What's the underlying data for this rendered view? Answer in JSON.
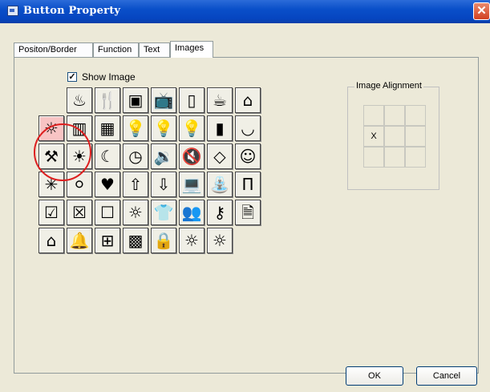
{
  "window": {
    "title": "Button Property",
    "close_label": "✕"
  },
  "tabs": [
    {
      "label": "Positon/Border"
    },
    {
      "label": "Function"
    },
    {
      "label": "Text"
    },
    {
      "label": "Images"
    }
  ],
  "show_image": {
    "label": "Show Image",
    "checked": true,
    "mark": "✓"
  },
  "icons": [
    [
      {
        "name": "heater-icon",
        "glyph": "♨"
      },
      {
        "name": "fork-knife-icon",
        "glyph": "🍴"
      },
      {
        "name": "oven-icon",
        "glyph": "▣"
      },
      {
        "name": "tv-icon",
        "glyph": "📺"
      },
      {
        "name": "document-icon",
        "glyph": "▯"
      },
      {
        "name": "coffee-cup-icon",
        "glyph": "☕"
      },
      {
        "name": "home-icon",
        "glyph": "⌂"
      }
    ],
    [
      {
        "name": "sun-selected-icon",
        "glyph": "☼",
        "selected": true
      },
      {
        "name": "piano-icon",
        "glyph": "▥"
      },
      {
        "name": "theater-icon",
        "glyph": "▦"
      },
      {
        "name": "lightbulb-on-icon",
        "glyph": "💡"
      },
      {
        "name": "lightbulb-glow-icon",
        "glyph": "💡"
      },
      {
        "name": "lightbulb-icon",
        "glyph": "💡"
      },
      {
        "name": "film-icon",
        "glyph": "▮"
      },
      {
        "name": "bowl-icon",
        "glyph": "◡"
      }
    ],
    [
      {
        "name": "tools-icon",
        "glyph": "⚒"
      },
      {
        "name": "lamp-icon",
        "glyph": "☀"
      },
      {
        "name": "moon-icon",
        "glyph": "☾"
      },
      {
        "name": "clock-icon",
        "glyph": "◷"
      },
      {
        "name": "speaker-icon",
        "glyph": "🔉"
      },
      {
        "name": "mute-icon",
        "glyph": "🔇"
      },
      {
        "name": "eraser-icon",
        "glyph": "◇"
      },
      {
        "name": "smiley-icon",
        "glyph": "☺"
      }
    ],
    [
      {
        "name": "sparkle-icon",
        "glyph": "✳"
      },
      {
        "name": "balloons-icon",
        "glyph": "⚪"
      },
      {
        "name": "hearts-icon",
        "glyph": "♥"
      },
      {
        "name": "arrow-up-icon",
        "glyph": "⇧"
      },
      {
        "name": "arrow-down-icon",
        "glyph": "⇩"
      },
      {
        "name": "computer-icon",
        "glyph": "💻"
      },
      {
        "name": "fountain-icon",
        "glyph": "⛲"
      },
      {
        "name": "curtain-icon",
        "glyph": "Π"
      }
    ],
    [
      {
        "name": "checked-box-icon",
        "glyph": "☑"
      },
      {
        "name": "crossed-box-icon",
        "glyph": "☒"
      },
      {
        "name": "empty-box-icon",
        "glyph": "☐"
      },
      {
        "name": "small-sun-icon",
        "glyph": "☼"
      },
      {
        "name": "shirt-icon",
        "glyph": "👕"
      },
      {
        "name": "people-icon",
        "glyph": "👥"
      },
      {
        "name": "key-icon",
        "glyph": "⚷"
      },
      {
        "name": "page-icon",
        "glyph": "🗎"
      }
    ],
    [
      {
        "name": "home-button-icon",
        "glyph": "⌂"
      },
      {
        "name": "bell-icon",
        "glyph": "🔔"
      },
      {
        "name": "presentation-icon",
        "glyph": "⊞"
      },
      {
        "name": "map-icon",
        "glyph": "▩"
      },
      {
        "name": "lock-icon",
        "glyph": "🔒"
      },
      {
        "name": "brightness-up-icon",
        "glyph": "☼"
      },
      {
        "name": "brightness-down-icon",
        "glyph": "☼"
      }
    ]
  ],
  "image_alignment": {
    "label": "Image Alignment",
    "cells": [
      "",
      "",
      "",
      "X",
      "",
      "",
      "",
      "",
      ""
    ]
  },
  "buttons": {
    "ok": "OK",
    "cancel": "Cancel"
  }
}
